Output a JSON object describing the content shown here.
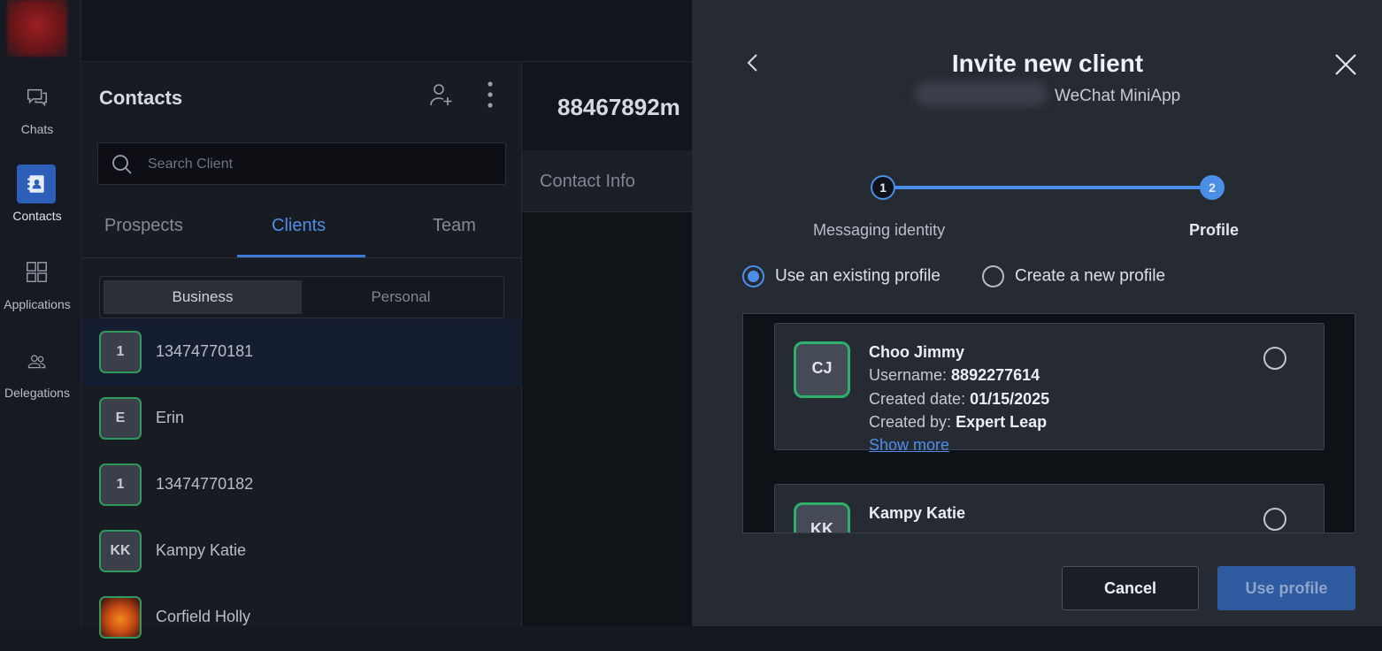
{
  "rail": {
    "items": [
      {
        "label": "Chats",
        "icon": "chat-icon"
      },
      {
        "label": "Contacts",
        "icon": "contacts-icon"
      },
      {
        "label": "Applications",
        "icon": "apps-grid-icon"
      },
      {
        "label": "Delegations",
        "icon": "delegations-icon"
      }
    ],
    "accent": "#2d5fb8"
  },
  "contacts": {
    "title": "Contacts",
    "search_placeholder": "Search Client",
    "tabs": [
      "Prospects",
      "Clients",
      "Team"
    ],
    "active_tab": "Clients",
    "segments": [
      "Business",
      "Personal"
    ],
    "active_segment": "Business",
    "rows": [
      {
        "avatar": "1",
        "name": "13474770181"
      },
      {
        "avatar": "E",
        "name": "Erin"
      },
      {
        "avatar": "1",
        "name": "13474770182"
      },
      {
        "avatar": "KK",
        "name": "Kampy Katie"
      },
      {
        "avatar": "",
        "name": "Corfield Holly"
      }
    ]
  },
  "middle": {
    "header": "88467892m",
    "tab": "Contact Info"
  },
  "modal": {
    "title": "Invite new client",
    "subtitle": "WeChat MiniApp",
    "steps": [
      {
        "number": "1",
        "label": "Messaging identity"
      },
      {
        "number": "2",
        "label": "Profile"
      }
    ],
    "options": [
      "Use an existing profile",
      "Create a new profile"
    ],
    "selected_option": "Use an existing profile",
    "profiles": [
      {
        "initials": "CJ",
        "name": "Choo Jimmy",
        "username_label": "Username:",
        "username": "8892277614",
        "created_date_label": "Created date:",
        "created_date": "01/15/2025",
        "created_by_label": "Created by:",
        "created_by": "Expert Leap",
        "show_more": "Show more"
      },
      {
        "initials": "KK",
        "name": "Kampy Katie"
      }
    ],
    "cancel_label": "Cancel",
    "use_label": "Use profile",
    "accent": "#4b8ee8"
  }
}
